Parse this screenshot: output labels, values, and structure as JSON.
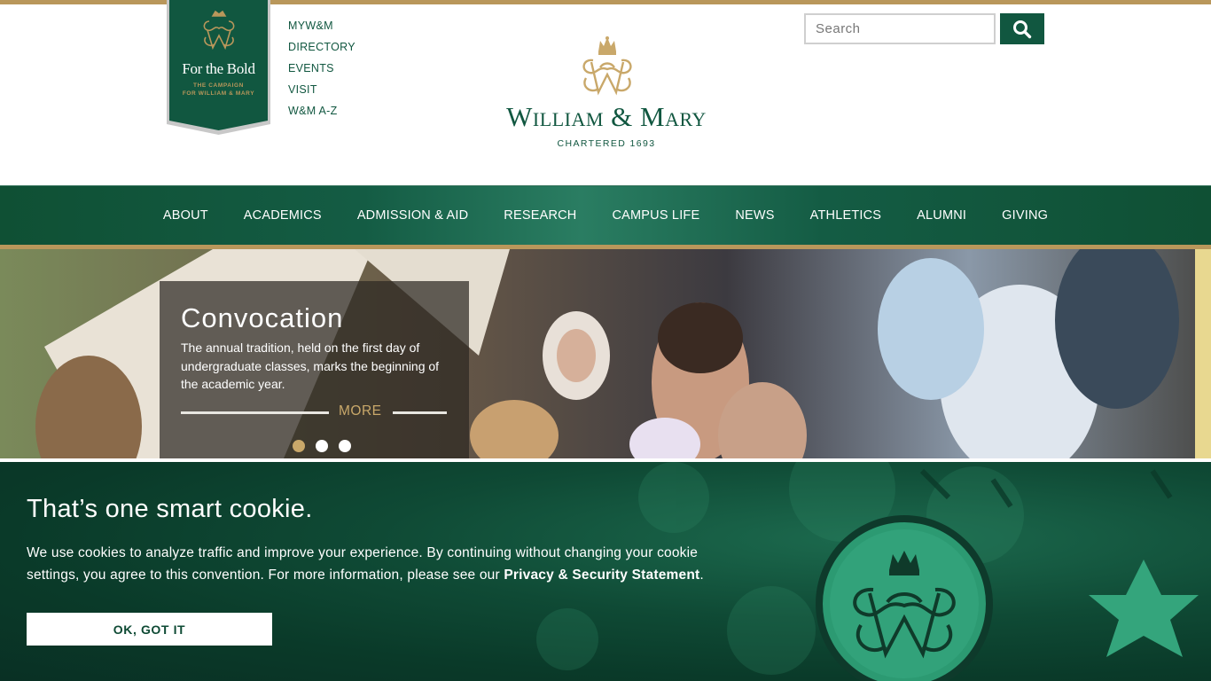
{
  "campaign": {
    "title": "For the Bold",
    "subtitle_line1": "THE CAMPAIGN",
    "subtitle_line2": "FOR WILLIAM & MARY"
  },
  "utility_nav": [
    "MYW&M",
    "DIRECTORY",
    "EVENTS",
    "VISIT",
    "W&M A-Z"
  ],
  "brand": {
    "name": "William & Mary",
    "tagline": "CHARTERED 1693"
  },
  "search": {
    "placeholder": "Search",
    "icon": "search-icon"
  },
  "main_nav": [
    "ABOUT",
    "ACADEMICS",
    "ADMISSION & AID",
    "RESEARCH",
    "CAMPUS LIFE",
    "NEWS",
    "ATHLETICS",
    "ALUMNI",
    "GIVING"
  ],
  "hero": {
    "title": "Convocation",
    "text": "The annual tradition, held on the first day of undergraduate classes, marks the beginning of the academic year.",
    "more_label": "MORE",
    "slides_total": 3,
    "active_slide": 1
  },
  "cookie": {
    "title": "That’s one smart cookie.",
    "text_before": "We use cookies to analyze traffic and improve your experience. By continuing without changing your cookie settings, you agree to this convention. For more information, please see our ",
    "link_label": "Privacy & Security Statement",
    "text_after": ".",
    "button_label": "OK, GOT IT"
  },
  "colors": {
    "green": "#115740",
    "gold": "#b9975b",
    "caption_gold": "#c9a86a"
  }
}
